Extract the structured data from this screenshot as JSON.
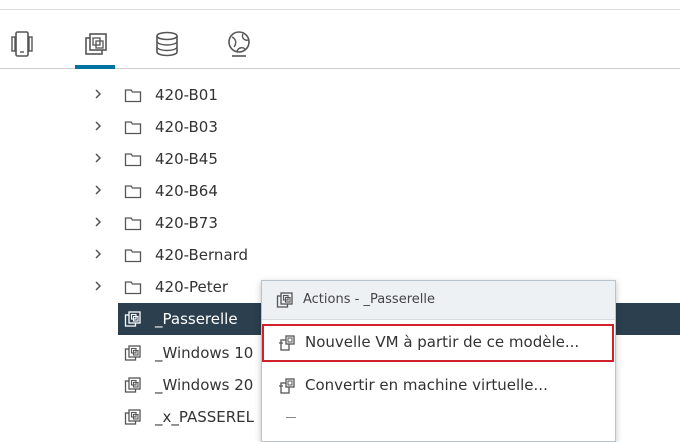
{
  "tabs": [
    {
      "name": "hosts-clusters",
      "icon": "phone-icon"
    },
    {
      "name": "vms-templates",
      "icon": "vm-copy-icon",
      "active": true
    },
    {
      "name": "storage",
      "icon": "database-icon"
    },
    {
      "name": "networking",
      "icon": "globe-icon"
    }
  ],
  "tree": {
    "folders": [
      "420-B01",
      "420-B03",
      "420-B45",
      "420-B64",
      "420-B73",
      "420-Bernard",
      "420-Peter"
    ],
    "selected": "_Passerelle",
    "vms": [
      "_Windows 10",
      "_Windows 20",
      "_x_PASSEREL"
    ]
  },
  "context_menu": {
    "title": "Actions - _Passerelle",
    "items": [
      "Nouvelle VM à partir de ce modèle...",
      "Convertir en machine virtuelle..."
    ]
  },
  "colors": {
    "accent": "#0072a3",
    "selected_row": "#2b3f4f",
    "highlight_border": "#d0202a"
  }
}
